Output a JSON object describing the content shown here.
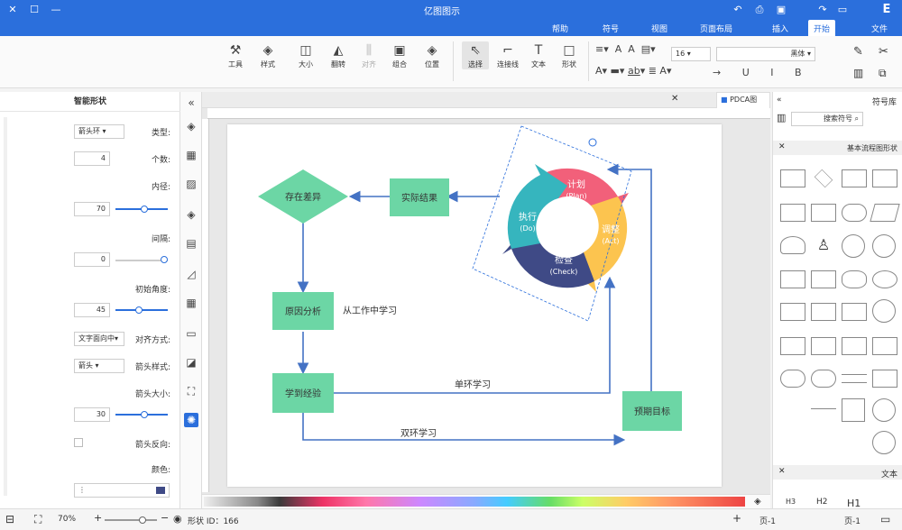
{
  "app": {
    "title": "亿图图示"
  },
  "menu": {
    "items": [
      "文件",
      "开始",
      "插入",
      "页面布局",
      "视图",
      "符号",
      "帮助"
    ]
  },
  "ribbon": {
    "tools": [
      {
        "label": "选择"
      },
      {
        "label": "连接线"
      },
      {
        "label": "文本"
      },
      {
        "label": "形状"
      },
      {
        "label": "位置"
      },
      {
        "label": "组合"
      },
      {
        "label": "对齐"
      },
      {
        "label": "翻转"
      },
      {
        "label": "大小"
      },
      {
        "label": "样式"
      },
      {
        "label": "工具"
      }
    ],
    "font_name": "黑体",
    "font_size": "16"
  },
  "left_panel": {
    "title": "智能形状",
    "fields": [
      {
        "label": "类型:",
        "value": "箭头环"
      },
      {
        "label": "个数:",
        "value": "4"
      },
      {
        "label": "内径:",
        "value": "70"
      },
      {
        "label": "间隔:",
        "value": "0"
      },
      {
        "label": "初始角度:",
        "value": "45"
      },
      {
        "label": "对齐方式:",
        "value": "文字面向中"
      },
      {
        "label": "箭头样式:",
        "value": "箭头"
      },
      {
        "label": "箭头大小:",
        "value": "30"
      },
      {
        "label": "箭头反向:",
        "value": ""
      },
      {
        "label": "颜色:",
        "value": ""
      }
    ]
  },
  "tabs": {
    "doc": "PDCA图"
  },
  "diagram": {
    "nodes": {
      "issue": "存在差异",
      "actual": "实际结果",
      "cause": "原因分析",
      "lesson": "学到经验",
      "target": "预期目标"
    },
    "labels": {
      "learn_work": "从工作中学习",
      "single": "单环学习",
      "double": "双环学习"
    },
    "pdca": [
      {
        "cn": "计划",
        "en": "(Plan)"
      },
      {
        "cn": "执行",
        "en": "(Do)"
      },
      {
        "cn": "检查",
        "en": "(Check)"
      },
      {
        "cn": "调整",
        "en": "(Act)"
      }
    ]
  },
  "right_panel": {
    "title": "符号库",
    "search_placeholder": "搜索符号",
    "category": "基本流程图形状",
    "text_section": "文本",
    "text_items": [
      "H1",
      "H2",
      "H3"
    ]
  },
  "status": {
    "page_tab": "页-1",
    "page_tab2": "页-1",
    "shape_id": "形状 ID：166",
    "zoom": "70%"
  },
  "colors": {
    "accent": "#2b6fdc",
    "node": "#6cd6a5",
    "plan": "#f2607a",
    "act": "#fcc44f",
    "check": "#3f4a86",
    "do": "#36b5be"
  }
}
